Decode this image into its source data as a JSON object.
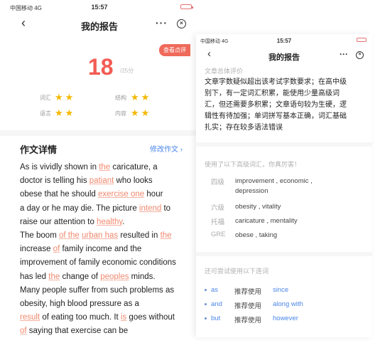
{
  "status_bar": {
    "carrier": "中国移动",
    "network": "4G",
    "time": "15:57"
  },
  "nav": {
    "back_glyph": "‹",
    "title": "我的报告",
    "more_glyph": "···",
    "close_glyph": "×"
  },
  "score_card": {
    "view_score_label": "查看点评",
    "score": "18",
    "score_total": "/25分",
    "categories": [
      {
        "label": "词汇",
        "stars": "★★"
      },
      {
        "label": "结构",
        "stars": "★★"
      },
      {
        "label": "语言",
        "stars": "★★"
      },
      {
        "label": "内容",
        "stars": "★★"
      }
    ]
  },
  "essay": {
    "heading": "作文详情",
    "edit_label": "修改作文 ›",
    "lines": [
      [
        {
          "t": "As is vividly shown in "
        },
        {
          "t": "the",
          "hl": true
        },
        {
          "t": " caricature, a"
        }
      ],
      [
        {
          "t": "doctor is telling his "
        },
        {
          "t": "patiant",
          "hl": true
        },
        {
          "t": " who looks"
        }
      ],
      [
        {
          "t": "obese that he should "
        },
        {
          "t": "exercise one",
          "hl": true
        },
        {
          "t": " hour"
        }
      ],
      [
        {
          "t": "a day or he may die. The picture "
        },
        {
          "t": "intend",
          "hl": true
        },
        {
          "t": " to"
        }
      ],
      [
        {
          "t": "raise our attention to "
        },
        {
          "t": "healthy",
          "hl": true
        },
        {
          "t": "."
        }
      ],
      [
        {
          "t": "The boom "
        },
        {
          "t": "of the",
          "hl": true
        },
        {
          "t": " "
        },
        {
          "t": "urban has",
          "hl": true
        },
        {
          "t": " resulted in "
        },
        {
          "t": "the",
          "hl": true
        }
      ],
      [
        {
          "t": "increase "
        },
        {
          "t": "of",
          "hl": true
        },
        {
          "t": " family income and the"
        }
      ],
      [
        {
          "t": "improvement of family economic conditions"
        }
      ],
      [
        {
          "t": "has led "
        },
        {
          "t": "the",
          "hl": true
        },
        {
          "t": " change of "
        },
        {
          "t": "peoples",
          "hl": true
        },
        {
          "t": " minds."
        }
      ],
      [
        {
          "t": "Many people suffer from such problems as"
        }
      ],
      [
        {
          "t": "obesity, high blood pressure as a"
        }
      ],
      [
        {
          "t": "result",
          "hl": true
        },
        {
          "t": " of eating too much. It "
        },
        {
          "t": "is",
          "hl": true
        },
        {
          "t": " goes without"
        }
      ],
      [
        {
          "t": "of",
          "hl": true
        },
        {
          "t": " saying that exercise can be"
        }
      ]
    ]
  },
  "report": {
    "overall_title": "文章总体评价",
    "overall_lines": [
      "文章字数疑似超出该考试字数要求；在高中级",
      "别下，有一定词汇积累，能使用少量高级词",
      "汇，但还需要多积累；文章语句较为生硬，逻",
      "辑性有待加强；单词拼写基本正确，词汇基础",
      "扎实；存在较多语法错误"
    ],
    "advanced_title": "使用了以下高级词汇，你真厉害！",
    "advanced_rows": [
      {
        "level": "四级",
        "words": [
          "improvement , economic ,",
          "depression"
        ]
      },
      {
        "level": "六级",
        "words": [
          "obesity , vitality"
        ]
      },
      {
        "level": "托福",
        "words": [
          "caricature , mentality"
        ]
      },
      {
        "level": "GRE",
        "words": [
          "obese , taking"
        ]
      }
    ],
    "connectors_title": "还可尝试使用以下连词",
    "connectors": [
      {
        "word": "as",
        "label": "推荐使用",
        "suggest": "since"
      },
      {
        "word": "and",
        "label": "推荐使用",
        "suggest": "along with"
      },
      {
        "word": "but",
        "label": "推荐使用",
        "suggest": "however"
      }
    ]
  },
  "colors": {
    "accent_red": "#f25c54",
    "star": "#f5b800",
    "link_blue": "#4a86e8",
    "error_orange": "#f0886d"
  }
}
